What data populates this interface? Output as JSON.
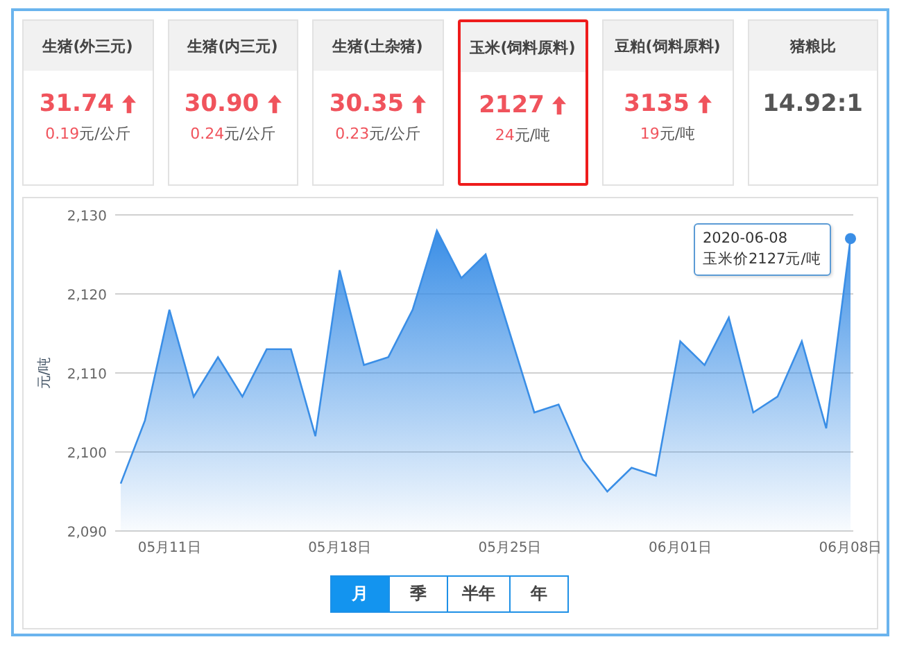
{
  "cards": [
    {
      "title": "生猪(外三元)",
      "price": "31.74",
      "kind": "up",
      "change": "0.19",
      "unit": "元/公斤",
      "selected": false
    },
    {
      "title": "生猪(内三元)",
      "price": "30.90",
      "kind": "up",
      "change": "0.24",
      "unit": "元/公斤",
      "selected": false
    },
    {
      "title": "生猪(土杂猪)",
      "price": "30.35",
      "kind": "up",
      "change": "0.23",
      "unit": "元/公斤",
      "selected": false
    },
    {
      "title": "玉米(饲料原料)",
      "price": "2127",
      "kind": "up",
      "change": "24",
      "unit": "元/吨",
      "selected": true
    },
    {
      "title": "豆粕(饲料原料)",
      "price": "3135",
      "kind": "up",
      "change": "19",
      "unit": "元/吨",
      "selected": false
    },
    {
      "title": "猪粮比",
      "price": "14.92:1",
      "kind": "plain",
      "selected": false
    }
  ],
  "chart": {
    "tooltip": {
      "date": "2020-06-08",
      "text": "玉米价2127元/吨"
    },
    "chart_data": {
      "type": "area",
      "ylabel": "元/吨",
      "categories": [
        null,
        null,
        "05月11日",
        null,
        null,
        null,
        null,
        null,
        null,
        "05月18日",
        null,
        null,
        null,
        null,
        null,
        null,
        "05月25日",
        null,
        null,
        null,
        null,
        null,
        null,
        "06月01日",
        null,
        null,
        null,
        null,
        null,
        null,
        "06月08日"
      ],
      "series": [
        {
          "color": "#3a8ee6",
          "values": [
            2096,
            2104,
            2118,
            2107,
            2112,
            2107,
            2113,
            2113,
            2102,
            2123,
            2111,
            2112,
            2118,
            2128,
            2122,
            2125,
            2115,
            2105,
            2106,
            2099,
            2095,
            2098,
            2097,
            2114,
            2111,
            2117,
            2105,
            2107,
            2114,
            2103,
            2127
          ]
        }
      ],
      "ylim": [
        2090,
        2130
      ],
      "grid": true,
      "yticks": [
        {
          "value": 2090,
          "label": "2,090"
        },
        {
          "value": 2100,
          "label": "2,100"
        },
        {
          "value": 2110,
          "label": "2,110"
        },
        {
          "value": 2120,
          "label": "2,120"
        },
        {
          "value": 2130,
          "label": "2,130"
        }
      ]
    }
  },
  "periods": [
    {
      "label": "月",
      "selected": true
    },
    {
      "label": "季",
      "selected": false
    },
    {
      "label": "半年",
      "selected": false
    },
    {
      "label": "年",
      "selected": false
    }
  ]
}
